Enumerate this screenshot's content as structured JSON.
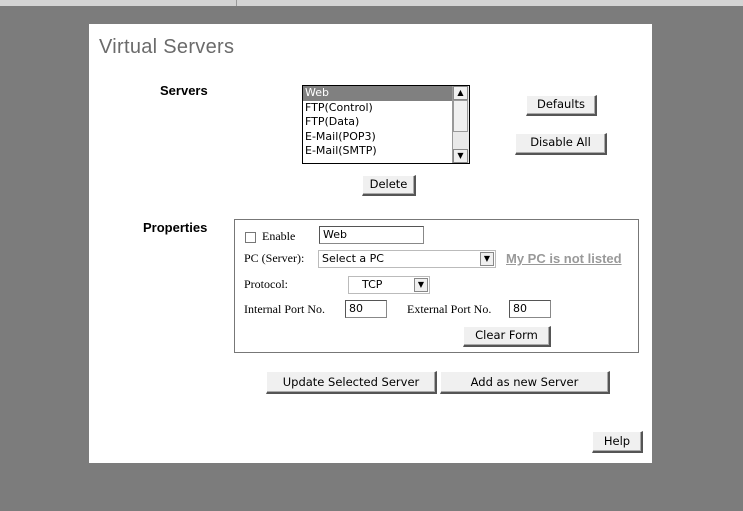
{
  "page": {
    "title": "Virtual Servers"
  },
  "servers": {
    "label": "Servers",
    "items": [
      "Web",
      "FTP(Control)",
      "FTP(Data)",
      "E-Mail(POP3)",
      "E-Mail(SMTP)"
    ],
    "selected_index": 0,
    "defaults_label": "Defaults",
    "disable_all_label": "Disable All",
    "delete_label": "Delete"
  },
  "properties": {
    "label": "Properties",
    "enable_label": "Enable",
    "enable_checked": false,
    "name_value": "Web",
    "pc_label": "PC (Server):",
    "pc_value": "Select a PC",
    "my_pc_link": "My PC is not listed",
    "protocol_label": "Protocol:",
    "protocol_value": "TCP",
    "internal_port_label": "Internal Port No.",
    "internal_port_value": "80",
    "external_port_label": "External Port No.",
    "external_port_value": "80",
    "clear_form_label": "Clear Form"
  },
  "actions": {
    "update_label": "Update Selected Server",
    "add_label": "Add as new Server",
    "help_label": "Help"
  },
  "icons": {
    "scroll_up": "▲",
    "scroll_down": "▼",
    "dropdown": "▼"
  },
  "colors": {
    "background": "#7c7c7c",
    "title": "#6b6b6b",
    "link": "#999999",
    "selection": "#808080"
  }
}
